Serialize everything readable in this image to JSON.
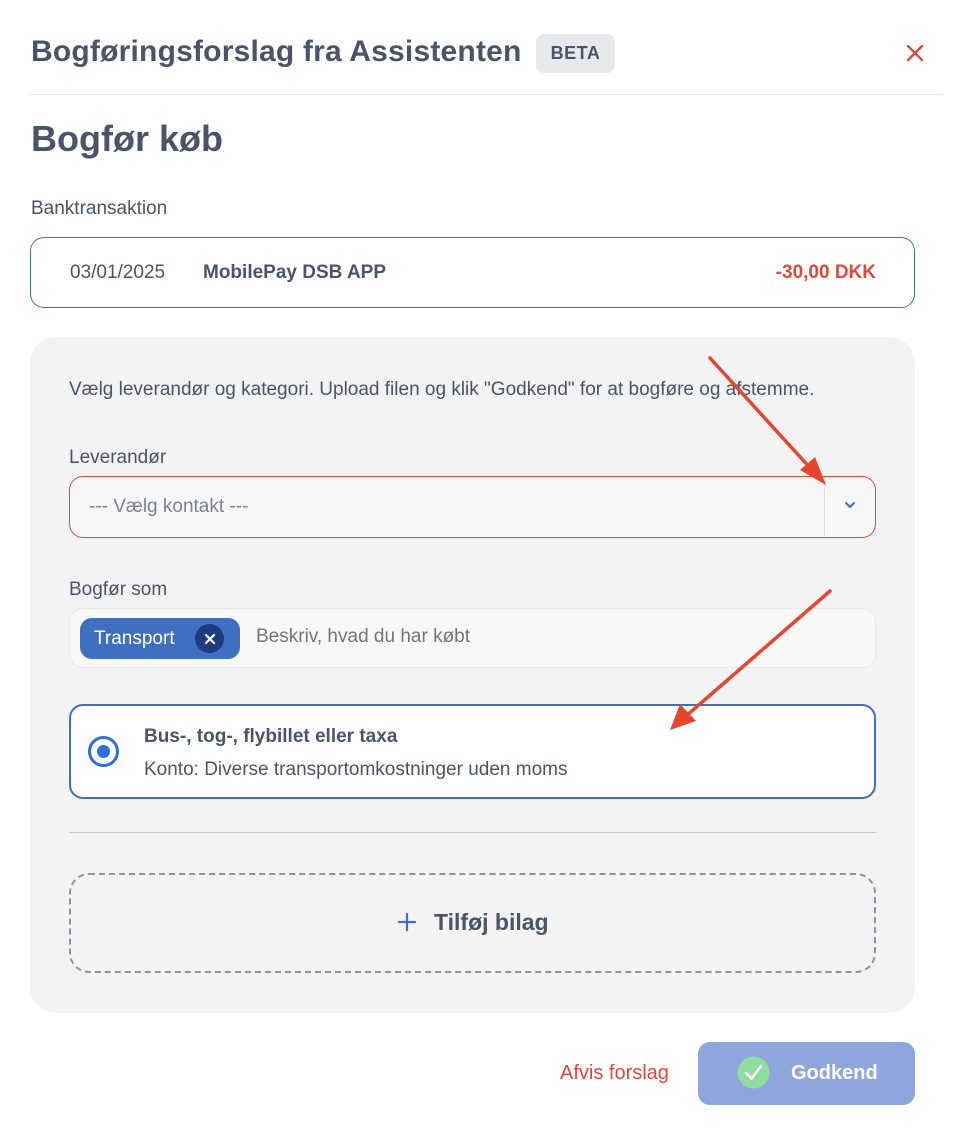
{
  "header": {
    "title": "Bogføringsforslag fra Assistenten",
    "badge": "BETA"
  },
  "page_heading": "Bogfør køb",
  "bank_transaction": {
    "label": "Banktransaktion",
    "date": "03/01/2025",
    "description": "MobilePay DSB APP",
    "amount": "-30,00 DKK"
  },
  "form": {
    "instructions": "Vælg leverandør og kategori. Upload filen og klik \"Godkend\" for at bogføre og afstemme.",
    "supplier_label": "Leverandør",
    "supplier_placeholder": "--- Vælg kontakt ---",
    "post_as_label": "Bogfør som",
    "selected_tag": "Transport",
    "describe_placeholder": "Beskriv, hvad du har købt",
    "option": {
      "title": "Bus-, tog-, flybillet eller taxa",
      "subtitle": "Konto: Diverse transportomkostninger uden moms"
    },
    "add_attachment": "Tilføj bilag"
  },
  "footer": {
    "reject": "Afvis forslag",
    "approve": "Godkend"
  },
  "colors": {
    "accent": "#3f6fc0",
    "error": "#e0493a",
    "approve_button": "#8ea6dc",
    "check_green": "#8fdca0"
  }
}
